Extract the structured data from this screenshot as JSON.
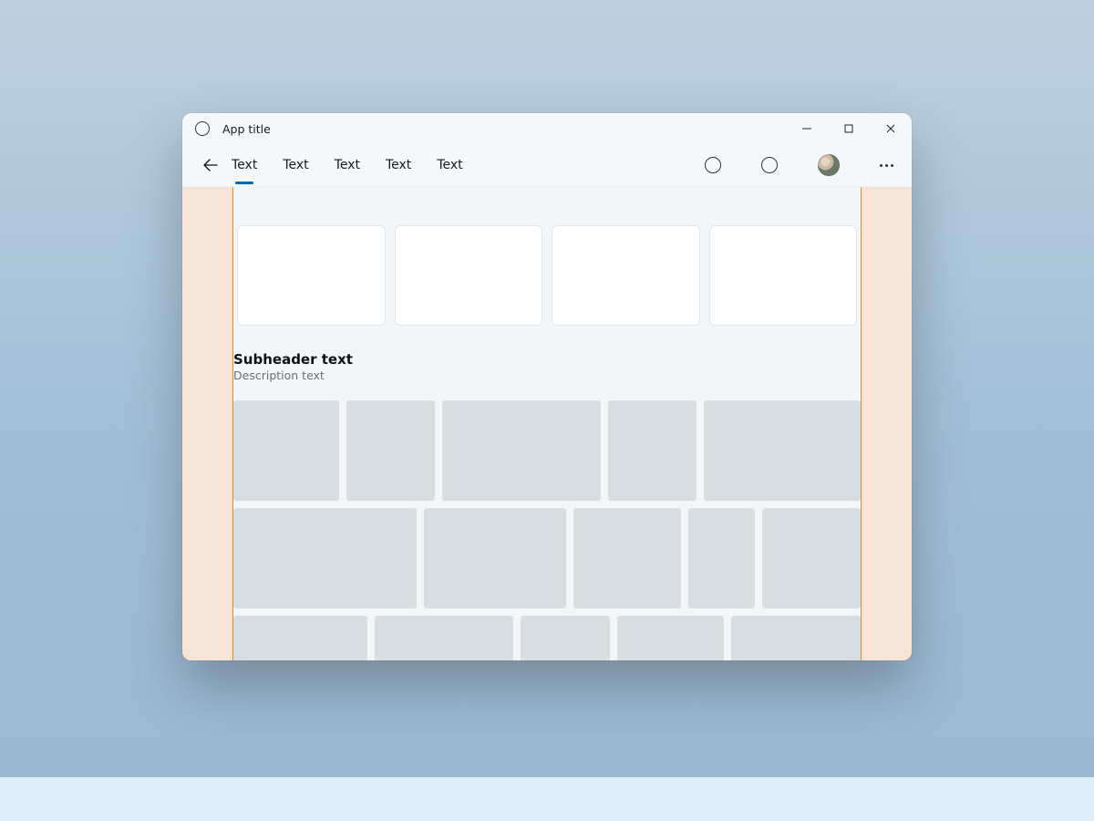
{
  "titlebar": {
    "app_title": "App title"
  },
  "nav": {
    "tabs": [
      {
        "label": "Text",
        "active": true
      },
      {
        "label": "Text",
        "active": false
      },
      {
        "label": "Text",
        "active": false
      },
      {
        "label": "Text",
        "active": false
      },
      {
        "label": "Text",
        "active": false
      }
    ]
  },
  "section": {
    "subheader": "Subheader text",
    "description": "Description text"
  },
  "layout": {
    "card_count": 4,
    "tile_rows": [
      {
        "widths": [
          120,
          100,
          180,
          100,
          178
        ]
      },
      {
        "widths": [
          205,
          160,
          120,
          75,
          110
        ]
      },
      {
        "widths": [
          150,
          155,
          100,
          120,
          145
        ]
      }
    ]
  }
}
